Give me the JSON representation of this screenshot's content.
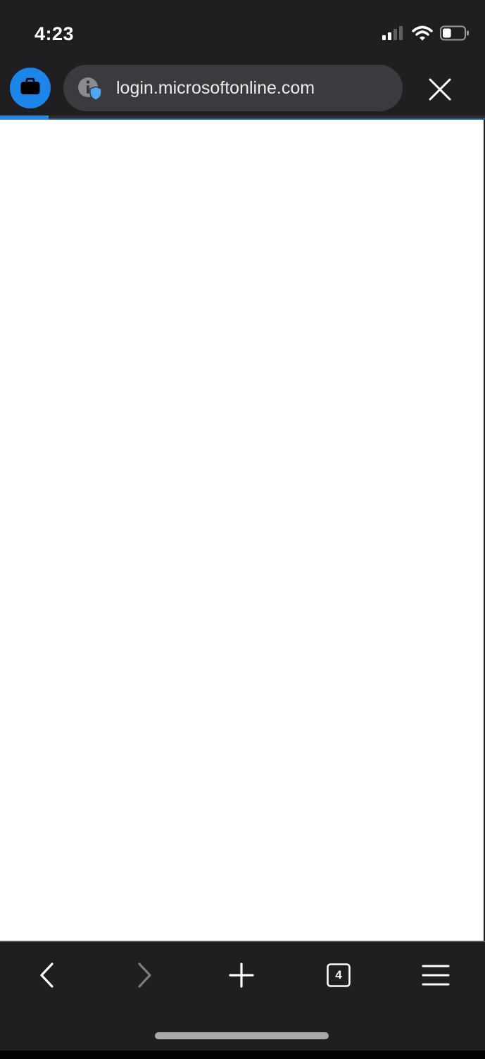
{
  "status_bar": {
    "time": "4:23",
    "icons": [
      "cellular-signal-icon",
      "wifi-icon",
      "battery-icon"
    ],
    "battery_level_percent": 40
  },
  "toolbar": {
    "work_profile_icon": "briefcase-icon",
    "site_info_icon": "info-shield-icon",
    "url": "login.microsoftonline.com",
    "close_icon": "close-icon"
  },
  "page_load": {
    "progress_fraction": 0.1
  },
  "bottom_bar": {
    "buttons": [
      "back-icon",
      "forward-icon",
      "new-tab-icon",
      "tabs-icon",
      "menu-icon"
    ],
    "tab_count": "4"
  },
  "colors": {
    "chrome_background": "#1f1e21",
    "url_pill": "#3b3a3e",
    "accent": "#1b86e8",
    "shield": "#4ea6f5",
    "content_background": "#ffffff"
  }
}
